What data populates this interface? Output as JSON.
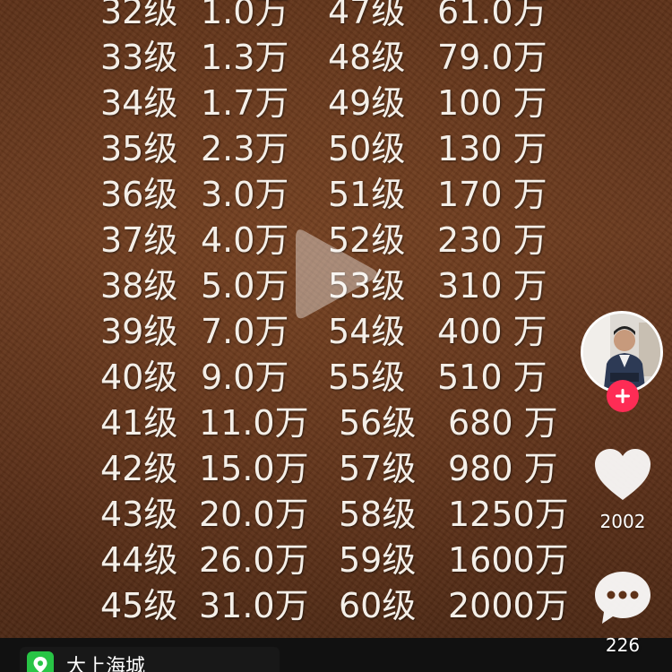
{
  "level_table": {
    "rows": [
      {
        "level_a": "32级",
        "amount_a": "1.0万",
        "level_b": "47级",
        "amount_b": "61.0万"
      },
      {
        "level_a": "33级",
        "amount_a": "1.3万",
        "level_b": "48级",
        "amount_b": "79.0万"
      },
      {
        "level_a": "34级",
        "amount_a": "1.7万",
        "level_b": "49级",
        "amount_b": "100 万"
      },
      {
        "level_a": "35级",
        "amount_a": "2.3万",
        "level_b": "50级",
        "amount_b": "130 万"
      },
      {
        "level_a": "36级",
        "amount_a": "3.0万",
        "level_b": "51级",
        "amount_b": "170 万"
      },
      {
        "level_a": "37级",
        "amount_a": "4.0万",
        "level_b": "52级",
        "amount_b": "230 万"
      },
      {
        "level_a": "38级",
        "amount_a": "5.0万",
        "level_b": "53级",
        "amount_b": "310 万"
      },
      {
        "level_a": "39级",
        "amount_a": "7.0万",
        "level_b": "54级",
        "amount_b": "400 万"
      },
      {
        "level_a": "40级",
        "amount_a": "9.0万",
        "level_b": "55级",
        "amount_b": "510 万"
      },
      {
        "level_a": "41级",
        "amount_a": "11.0万",
        "level_b": "56级",
        "amount_b": "680 万"
      },
      {
        "level_a": "42级",
        "amount_a": "15.0万",
        "level_b": "57级",
        "amount_b": "980 万"
      },
      {
        "level_a": "43级",
        "amount_a": "20.0万",
        "level_b": "58级",
        "amount_b": "1250万"
      },
      {
        "level_a": "44级",
        "amount_a": "26.0万",
        "level_b": "59级",
        "amount_b": "1600万"
      },
      {
        "level_a": "45级",
        "amount_a": "31.0万",
        "level_b": "60级",
        "amount_b": "2000万"
      }
    ]
  },
  "actions": {
    "like_count": "2002",
    "comment_count": "226",
    "like_icon": "heart-icon",
    "comment_icon": "comment-bubble-icon",
    "follow_icon": "plus-icon"
  },
  "location": {
    "text": "大上海城",
    "icon": "location-pin-icon"
  },
  "colors": {
    "follow_accent": "#fe2c55",
    "location_accent": "#28c445"
  }
}
